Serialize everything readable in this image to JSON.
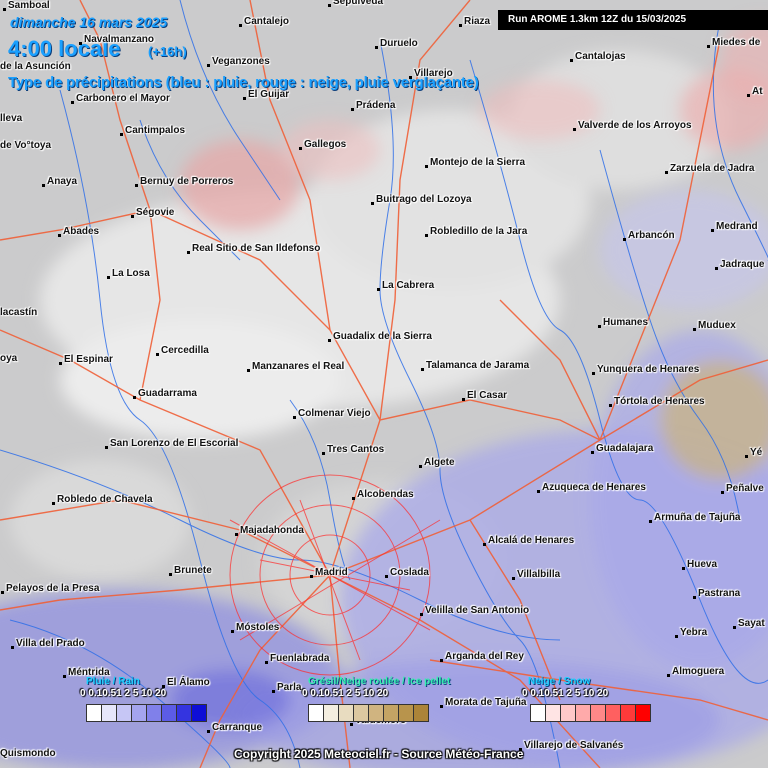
{
  "header": {
    "date": "dimanche 16 mars 2025",
    "time": "4:00 locale",
    "offset": "(+16h)",
    "subtitle": "Type de précipitations (bleu : pluie, rouge : neige, pluie verglaçante)",
    "run": "Run AROME 1.3km 12Z du 15/03/2025"
  },
  "cities": [
    {
      "name": "Samboal"
    },
    {
      "name": "Navalmanzano"
    },
    {
      "name": "Cantalejo"
    },
    {
      "name": "Sepúlveda"
    },
    {
      "name": "Riaza"
    },
    {
      "name": "Duruelo"
    },
    {
      "name": "Miedes de"
    },
    {
      "name": "de la Asunción"
    },
    {
      "name": "Veganzones"
    },
    {
      "name": "Cantalojas"
    },
    {
      "name": "Villarejo"
    },
    {
      "name": "Carbonero el Mayor"
    },
    {
      "name": "El Guijar"
    },
    {
      "name": "Prádena"
    },
    {
      "name": "lleva"
    },
    {
      "name": "Valverde de los Arroyos"
    },
    {
      "name": "Cantimpalos"
    },
    {
      "name": "de Vo°toya"
    },
    {
      "name": "Gallegos"
    },
    {
      "name": "Montejo de la Sierra"
    },
    {
      "name": "Zarzuela de Jadra"
    },
    {
      "name": "Anaya"
    },
    {
      "name": "Bernuy de Porreros"
    },
    {
      "name": "Buitrago del Lozoya"
    },
    {
      "name": "Ségovie"
    },
    {
      "name": "Abades"
    },
    {
      "name": "Robledillo de la Jara"
    },
    {
      "name": "Arbancón"
    },
    {
      "name": "Medrand"
    },
    {
      "name": "Real Sitio de San Ildefonso"
    },
    {
      "name": "Jadraque"
    },
    {
      "name": "La Losa"
    },
    {
      "name": "La Cabrera"
    },
    {
      "name": "lacastín"
    },
    {
      "name": "Humanes"
    },
    {
      "name": "Muduex"
    },
    {
      "name": "Guadalix de la Sierra"
    },
    {
      "name": "Cercedilla"
    },
    {
      "name": "oya"
    },
    {
      "name": "El Espinar"
    },
    {
      "name": "Talamanca de Jarama"
    },
    {
      "name": "Manzanares el Real"
    },
    {
      "name": "Yunquera de Henares"
    },
    {
      "name": "Guadarrama"
    },
    {
      "name": "El Casar"
    },
    {
      "name": "Tórtola de Henares"
    },
    {
      "name": "Colmenar Viejo"
    },
    {
      "name": "San Lorenzo de El Escorial"
    },
    {
      "name": "Tres Cantos"
    },
    {
      "name": "Guadalajara"
    },
    {
      "name": "Algete"
    },
    {
      "name": "Alcobendas"
    },
    {
      "name": "Azuqueca de Henares"
    },
    {
      "name": "Peñalve"
    },
    {
      "name": "Robledo de Chavela"
    },
    {
      "name": "Armuña de Tajuña"
    },
    {
      "name": "Majadahonda"
    },
    {
      "name": "Alcalá de Henares"
    },
    {
      "name": "Brunete"
    },
    {
      "name": "Madrid"
    },
    {
      "name": "Coslada"
    },
    {
      "name": "Villalbilla"
    },
    {
      "name": "Huevа"
    },
    {
      "name": "Pelayos de la Presa"
    },
    {
      "name": "Pastrana"
    },
    {
      "name": "Villa del Prado"
    },
    {
      "name": "Móstoles"
    },
    {
      "name": "Velilla de San Antonio"
    },
    {
      "name": "Sayat"
    },
    {
      "name": "Yebra"
    },
    {
      "name": "Fuenlabrada"
    },
    {
      "name": "Arganda del Rey"
    },
    {
      "name": "Méntrida"
    },
    {
      "name": "El Álamo"
    },
    {
      "name": "Almoguera"
    },
    {
      "name": "Parla"
    },
    {
      "name": "Morata de Tajuña"
    },
    {
      "name": "Valdemoro"
    },
    {
      "name": "Carranque"
    },
    {
      "name": "Quismondo"
    },
    {
      "name": "Villarejo de Salvanés"
    },
    {
      "name": "Yé"
    },
    {
      "name": "At"
    }
  ],
  "legend": {
    "rain": {
      "title": "Pluie / Rain",
      "ticks": "0  0.10.51  2  5  10 20",
      "color": "#1ad0ff",
      "swatches": [
        "#ffffff",
        "#e6e6fa",
        "#c6c6f5",
        "#a4a4ee",
        "#8080ea",
        "#5c5ce6",
        "#3434e0",
        "#0e0ed6"
      ]
    },
    "graupel": {
      "title": "Grésil/Neige roulée / Ice pellet",
      "ticks": "0  0.10.51  2  5  10 20",
      "color": "#35f0b0",
      "swatches": [
        "#ffffff",
        "#f4eee0",
        "#e8dcc0",
        "#dcc8a0",
        "#d0b480",
        "#c4a464",
        "#b8944c",
        "#ac8438"
      ]
    },
    "snow": {
      "title": "Neige / Snow",
      "ticks": "0  0.10.51  2  5  10 20",
      "color": "#1ad0ff",
      "swatches": [
        "#ffffff",
        "#ffe4e4",
        "#ffc8c8",
        "#ffaaaa",
        "#ff8888",
        "#ff6060",
        "#ff3a3a",
        "#ff0000"
      ]
    }
  },
  "copyright": "Copyright 2025 Meteociel.fr - Source Météo-France"
}
